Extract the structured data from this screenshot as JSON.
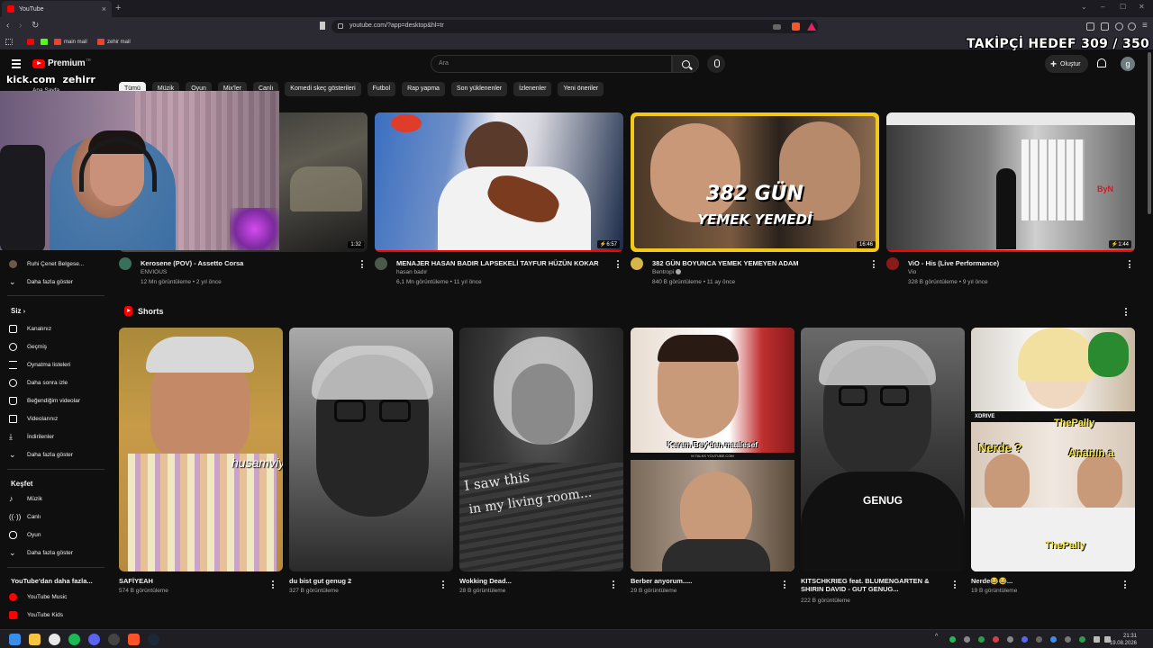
{
  "browser": {
    "tab_title": "YouTube",
    "url": "youtube.com/?app=desktop&hl=tr",
    "bookmarks": [
      "main mail",
      "zehir mail"
    ]
  },
  "overlay": {
    "takipci": "TAKİPÇİ HEDEF 309 / 350",
    "kick_domain": "kick.com",
    "kick_user": "zehirr"
  },
  "masthead": {
    "logo_text": "Premium",
    "logo_region": "TR",
    "search_placeholder": "Ara",
    "create_label": "Oluştur",
    "avatar_letter": "g"
  },
  "chips": [
    "Tümü",
    "Müzik",
    "Oyun",
    "Mix'ler",
    "Canlı",
    "Komedi skeç gösterileri",
    "Futbol",
    "Rap yapma",
    "Son yüklenenler",
    "İzlenenler",
    "Yeni öneriler"
  ],
  "sidebar": {
    "partial_top": "Ana Sayfa",
    "subscription_item": "Ruhi Çenet Belgese...",
    "show_more_1": "Daha fazla göster",
    "you_header": "Siz",
    "you_items": [
      "Kanalınız",
      "Geçmiş",
      "Oynatma listeleri",
      "Daha sonra izle",
      "Beğendiğim videolar",
      "Videolarınız",
      "İndirilenler",
      "Daha fazla göster"
    ],
    "explore_header": "Keşfet",
    "explore_items": [
      "Müzik",
      "Canlı",
      "Oyun",
      "Daha fazla göster"
    ],
    "more_header": "YouTube'dan daha fazla...",
    "more_items": [
      "YouTube Music",
      "YouTube Kids"
    ]
  },
  "videos": [
    {
      "title": "Kerosene (POV) - Assetto Corsa",
      "channel": "ENVIOUS",
      "views": "12 Mn görüntüleme",
      "age": "2 yıl önce",
      "duration": "1:32",
      "verified": false
    },
    {
      "title": "MENAJER HASAN BADIR LAPSEKELİ TAYFUR HÜZÜN KOKAR",
      "channel": "hasan badır",
      "views": "6,1 Mn görüntüleme",
      "age": "11 yıl önce",
      "duration": "6:57",
      "verified": false
    },
    {
      "title": "382 GÜN BOYUNCA YEMEK YEMEYEN ADAM",
      "channel": "Bentropi",
      "views": "840 B görüntüleme",
      "age": "11 ay önce",
      "duration": "16:46",
      "verified": true,
      "thumb_text_1": "382 GÜN",
      "thumb_text_2": "YEMEK YEMEDİ"
    },
    {
      "title": "ViO - His (Live Performance)",
      "channel": "Vio",
      "views": "328 B görüntüleme",
      "age": "9 yıl önce",
      "duration": "1:44",
      "verified": false,
      "thumb_text": "ByN"
    }
  ],
  "shorts": {
    "header": "Shorts",
    "items": [
      {
        "title": "SAFİYEAH",
        "views": "574 B görüntüleme",
        "thumb_text": "husamviy"
      },
      {
        "title": "du bist gut genug 2",
        "views": "327 B görüntüleme"
      },
      {
        "title": "Wokking Dead...",
        "views": "28 B görüntüleme",
        "thumb_text_1": "I saw this",
        "thumb_text_2": "in my living room..."
      },
      {
        "title": "Berber anyorum.....",
        "views": "29 B görüntüleme",
        "thumb_caption": "Kerem Bey'den maalesef",
        "thumb_sub": "M TALKS YOUTUBE.COM"
      },
      {
        "title": "KITSCHKRIEG feat. BLUMENGARTEN & SHIRIN DAVID - GUT GENUG...",
        "title_line1": "KITSCHKRIEG feat. BLUMENGARTEN &",
        "title_line2": "SHIRIN DAVID - GUT GENUG...",
        "views": "222 B görüntüleme",
        "thumb_text": "GENUG"
      },
      {
        "title": "Nerde😂😂...",
        "views": "19 B görüntüleme",
        "thumb_text_1": "Nerde ?",
        "thumb_text_2": "Ananın a",
        "thumb_tag": "ThePally",
        "thumb_brand": "XDRIVE"
      }
    ]
  },
  "taskbar": {
    "time": "21:31",
    "date": "19.08.2026"
  }
}
